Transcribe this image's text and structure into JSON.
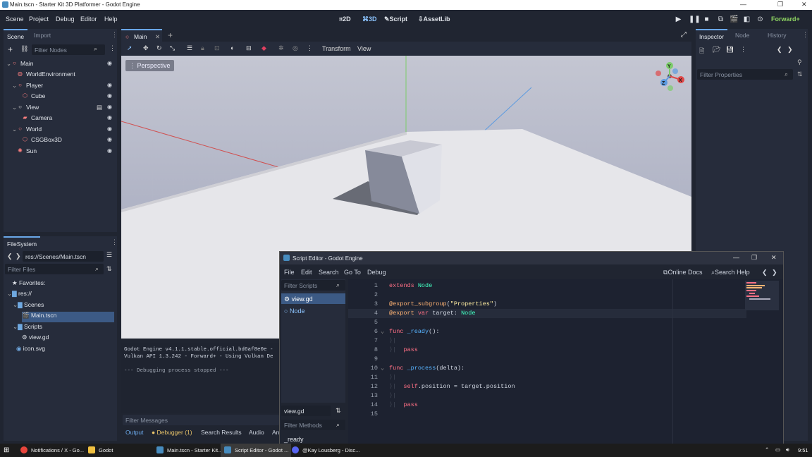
{
  "window": {
    "title": "Main.tscn - Starter Kit 3D Platformer - Godot Engine",
    "minimize": "—",
    "maximize": "❐",
    "close": "✕"
  },
  "menu": [
    "Scene",
    "Project",
    "Debug",
    "Editor",
    "Help"
  ],
  "workspaces": {
    "w2d": "2D",
    "w3d": "3D",
    "script": "Script",
    "assetlib": "AssetLib"
  },
  "renderer": "Forward+",
  "scene_dock": {
    "tab_scene": "Scene",
    "tab_import": "Import",
    "filter_placeholder": "Filter Nodes",
    "nodes": [
      {
        "label": "Main",
        "icon": "node3d-icon",
        "color": "#fc7f7f"
      },
      {
        "label": "WorldEnvironment",
        "icon": "world-environment-icon",
        "color": "#fc7f7f"
      },
      {
        "label": "Player",
        "icon": "node3d-icon",
        "color": "#fc7f7f"
      },
      {
        "label": "Cube",
        "icon": "mesh-icon",
        "color": "#fc7f7f"
      },
      {
        "label": "View",
        "icon": "node-icon",
        "color": "#e0e0e0"
      },
      {
        "label": "Camera",
        "icon": "camera-icon",
        "color": "#fc7f7f"
      },
      {
        "label": "World",
        "icon": "node3d-icon",
        "color": "#fc7f7f"
      },
      {
        "label": "CSGBox3D",
        "icon": "csg-box-icon",
        "color": "#fc7f7f"
      },
      {
        "label": "Sun",
        "icon": "light-icon",
        "color": "#fc7f7f"
      }
    ]
  },
  "filesystem": {
    "tab": "FileSystem",
    "path": "res://Scenes/Main.tscn",
    "filter_placeholder": "Filter Files",
    "items": [
      "Favorites:",
      "res://",
      "Scenes",
      "Main.tscn",
      "Scripts",
      "view.gd",
      "icon.svg"
    ]
  },
  "editor_tabs": {
    "main": "Main"
  },
  "toolbar3d": {
    "transform": "Transform",
    "view": "View"
  },
  "viewport": {
    "perspective": "Perspective",
    "gizmo_y": "Y",
    "gizmo_x": "X",
    "gizmo_z": "Z"
  },
  "inspector": {
    "tab_inspector": "Inspector",
    "tab_node": "Node",
    "tab_history": "History",
    "filter_placeholder": "Filter Properties"
  },
  "output": {
    "lines": [
      "Godot Engine v4.1.1.stable.official.bd6af8e0e -",
      "Vulkan API 1.3.242 - Forward+ - Using Vulkan De",
      "",
      "--- Debugging process stopped ---"
    ],
    "filter_placeholder": "Filter Messages",
    "tabs": [
      "Output",
      "Debugger (1)",
      "Search Results",
      "Audio",
      "An"
    ]
  },
  "script_editor": {
    "title": "Script Editor - Godot Engine",
    "menu": [
      "File",
      "Edit",
      "Search",
      "Go To",
      "Debug"
    ],
    "online_docs": "Online Docs",
    "search_help": "Search Help",
    "filter_scripts": "Filter Scripts",
    "scripts": [
      "view.gd",
      "Node"
    ],
    "current": "view.gd",
    "filter_methods": "Filter Methods",
    "methods": [
      "_ready"
    ],
    "line_numbers": [
      "1",
      "2",
      "3",
      "4",
      "5",
      "6",
      "7",
      "8",
      "9",
      "10",
      "11",
      "12",
      "13",
      "14",
      "15"
    ]
  },
  "taskbar": {
    "items": [
      "Notifications / X - Go...",
      "Godot",
      "Main.tscn - Starter Kit...",
      "Script Editor - Godot ...",
      "@Kay Lousberg - Disc..."
    ],
    "time": "9:51"
  }
}
